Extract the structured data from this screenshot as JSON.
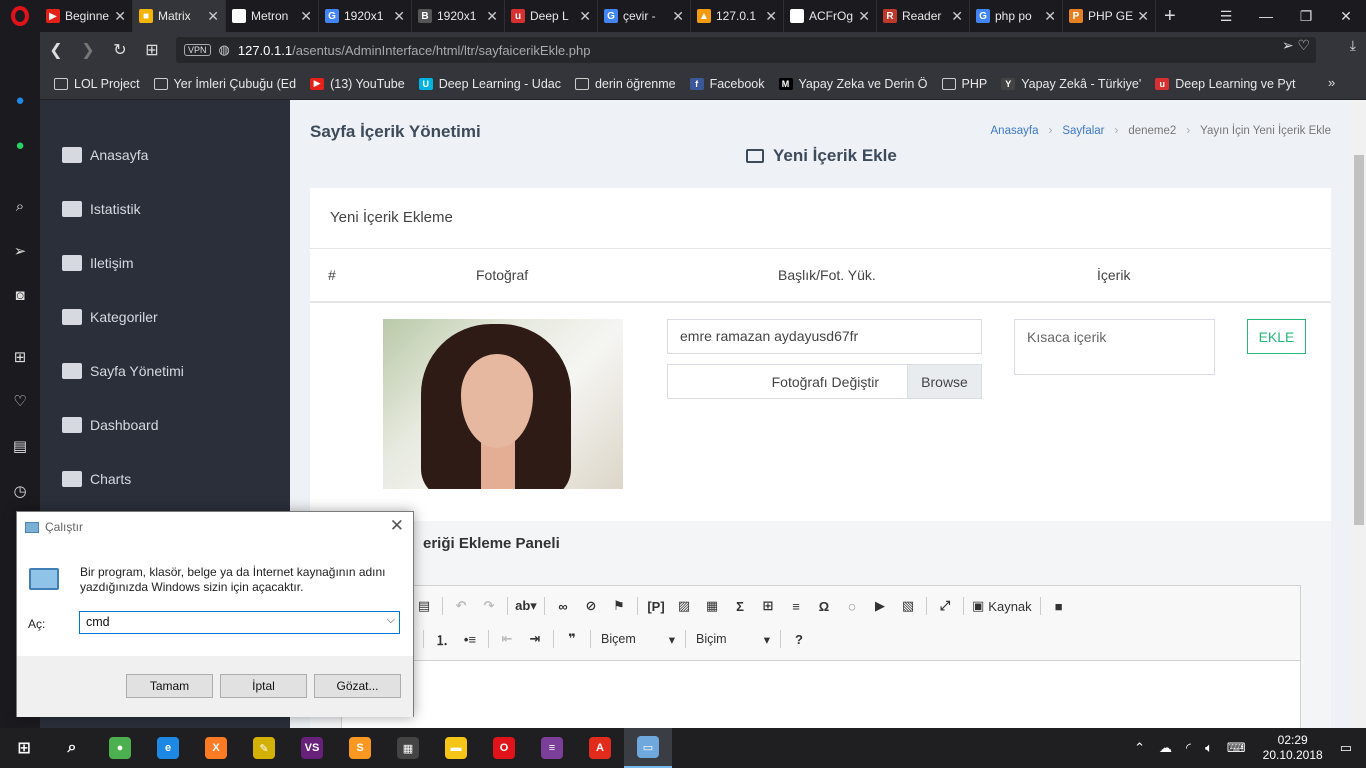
{
  "browser": {
    "tabs": [
      {
        "title": "Beginne",
        "fav_color": "#e62117",
        "fav": "▶",
        "active": false
      },
      {
        "title": "Matrix",
        "fav_color": "#f4b400",
        "fav": "■",
        "active": true
      },
      {
        "title": "Metron",
        "fav_color": "#ffffff",
        "fav": "",
        "active": false
      },
      {
        "title": "1920x1",
        "fav_color": "#4285f4",
        "fav": "G",
        "active": false
      },
      {
        "title": "1920x1",
        "fav_color": "#555555",
        "fav": "B",
        "active": false
      },
      {
        "title": "Deep L",
        "fav_color": "#d63031",
        "fav": "u",
        "active": false
      },
      {
        "title": "çevir - ",
        "fav_color": "#4285f4",
        "fav": "G",
        "active": false
      },
      {
        "title": "127.0.1",
        "fav_color": "#f39c12",
        "fav": "▲",
        "active": false
      },
      {
        "title": "ACFrOg",
        "fav_color": "#ffffff",
        "fav": "",
        "active": false
      },
      {
        "title": "Reader",
        "fav_color": "#c0392b",
        "fav": "R",
        "active": false
      },
      {
        "title": "php po",
        "fav_color": "#4285f4",
        "fav": "G",
        "active": false
      },
      {
        "title": "PHP GE",
        "fav_color": "#e67e22",
        "fav": "P",
        "active": false
      }
    ],
    "url_host": "127.0.1.1",
    "url_path": "/asentus/AdminInterface/html/ltr/sayfaicerikEkle.php",
    "vpn_label": "VPN",
    "bookmarks": [
      {
        "label": "LOL Project",
        "type": "folder"
      },
      {
        "label": "Yer İmleri Çubuğu (Ed",
        "type": "folder"
      },
      {
        "label": "(13) YouTube",
        "type": "icon",
        "color": "#e62117",
        "glyph": "▶"
      },
      {
        "label": "Deep Learning - Udac",
        "type": "icon",
        "color": "#02b3e4",
        "glyph": "U"
      },
      {
        "label": "derin öğrenme",
        "type": "folder"
      },
      {
        "label": "Facebook",
        "type": "icon",
        "color": "#3b5998",
        "glyph": "f"
      },
      {
        "label": "Yapay Zeka ve Derin Ö",
        "type": "icon",
        "color": "#000000",
        "glyph": "M"
      },
      {
        "label": "PHP",
        "type": "folder"
      },
      {
        "label": "Yapay Zekâ - Türkiye'",
        "type": "icon",
        "color": "#444444",
        "glyph": "Y"
      },
      {
        "label": "Deep Learning ve Pyt",
        "type": "icon",
        "color": "#d63031",
        "glyph": "u"
      }
    ]
  },
  "sidebar": {
    "items": [
      {
        "label": "Anasayfa"
      },
      {
        "label": "Istatistik"
      },
      {
        "label": "Iletişim"
      },
      {
        "label": "Kategoriler"
      },
      {
        "label": "Sayfa Yönetimi"
      },
      {
        "label": "Dashboard"
      },
      {
        "label": "Charts"
      }
    ]
  },
  "page": {
    "title": "Sayfa İçerik Yönetimi",
    "subtitle": "Yeni İçerik Ekle",
    "breadcrumb": [
      "Anasayfa",
      "Sayfalar",
      "deneme2",
      "Yayın İçin Yeni İçerik Ekle"
    ],
    "card_title": "Yeni İçerik Ekleme",
    "columns": [
      "#",
      "Fotoğraf",
      "Başlık/Fot. Yük.",
      "İçerik"
    ],
    "title_input_value": "emre ramazan aydayusd67fr",
    "file_label": "Fotoğrafı Değiştir",
    "browse_label": "Browse",
    "content_placeholder": "Kısaca içerik",
    "add_button": "EKLE",
    "panel_title": "eriği Ekleme Paneli",
    "editor": {
      "source_label": "Kaynak",
      "format1": "Biçem",
      "format2": "Biçim"
    }
  },
  "run_dialog": {
    "title": "Çalıştır",
    "description": "Bir program, klasör, belge ya da İnternet kaynağının adını yazdığınızda Windows sizin için açacaktır.",
    "open_label": "Aç:",
    "input_value": "cmd",
    "ok": "Tamam",
    "cancel": "İptal",
    "browse": "Gözat..."
  },
  "taskbar": {
    "time": "02:29",
    "date": "20.10.2018",
    "apps": [
      {
        "name": "chrome",
        "color": "#4caf50",
        "glyph": "●"
      },
      {
        "name": "edge",
        "color": "#1e88e5",
        "glyph": "e"
      },
      {
        "name": "xampp",
        "color": "#fb7a24",
        "glyph": "X"
      },
      {
        "name": "tool",
        "color": "#d4b106",
        "glyph": "✎"
      },
      {
        "name": "visual-studio",
        "color": "#68217a",
        "glyph": "VS"
      },
      {
        "name": "sublime",
        "color": "#f89820",
        "glyph": "S"
      },
      {
        "name": "calculator",
        "color": "#444444",
        "glyph": "▦"
      },
      {
        "name": "explorer",
        "color": "#f5c518",
        "glyph": "▬"
      },
      {
        "name": "opera",
        "color": "#e0121a",
        "glyph": "O"
      },
      {
        "name": "winrar",
        "color": "#7b3f99",
        "glyph": "≡"
      },
      {
        "name": "acrobat",
        "color": "#e32b1d",
        "glyph": "A"
      },
      {
        "name": "run",
        "color": "#6fa8dc",
        "glyph": "▭"
      }
    ]
  }
}
